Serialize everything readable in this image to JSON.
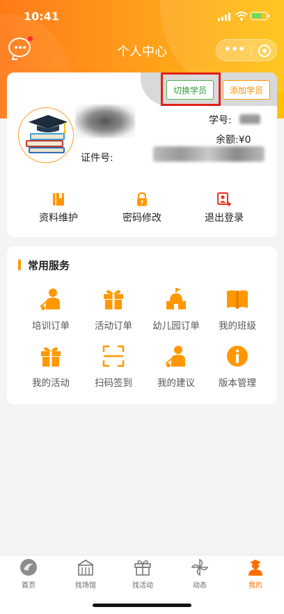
{
  "status_bar": {
    "time": "10:41"
  },
  "nav": {
    "title": "个人中心",
    "more_glyph": "•••"
  },
  "profile": {
    "switch_button": "切换学员",
    "add_button": "添加学员",
    "student_id_label": "学号:",
    "balance_label": "余额:¥0",
    "cert_label": "证件号:",
    "actions": [
      {
        "label": "资料维护",
        "icon": "profile-book-icon"
      },
      {
        "label": "密码修改",
        "icon": "lock-icon"
      },
      {
        "label": "退出登录",
        "icon": "logout-icon"
      }
    ]
  },
  "services": {
    "title": "常用服务",
    "items": [
      {
        "label": "培训订单",
        "icon": "teacher-icon"
      },
      {
        "label": "活动订单",
        "icon": "gift-icon"
      },
      {
        "label": "幼儿园订单",
        "icon": "school-icon"
      },
      {
        "label": "我的班级",
        "icon": "open-book-icon"
      },
      {
        "label": "我的活动",
        "icon": "gift-icon"
      },
      {
        "label": "扫码签到",
        "icon": "scan-icon"
      },
      {
        "label": "我的建议",
        "icon": "teacher-icon"
      },
      {
        "label": "版本管理",
        "icon": "info-icon"
      }
    ]
  },
  "tabbar": {
    "tabs": [
      {
        "label": "首页",
        "icon": "home-icon",
        "active": false
      },
      {
        "label": "找场馆",
        "icon": "venue-icon",
        "active": false
      },
      {
        "label": "找活动",
        "icon": "gift-icon",
        "active": false
      },
      {
        "label": "动态",
        "icon": "pinwheel-icon",
        "active": false
      },
      {
        "label": "我的",
        "icon": "user-icon",
        "active": true
      }
    ]
  },
  "colors": {
    "accent": "#ff9800",
    "active_tab": "#ff6d00",
    "green_button": "#4caf50",
    "highlight": "#e0201a"
  }
}
